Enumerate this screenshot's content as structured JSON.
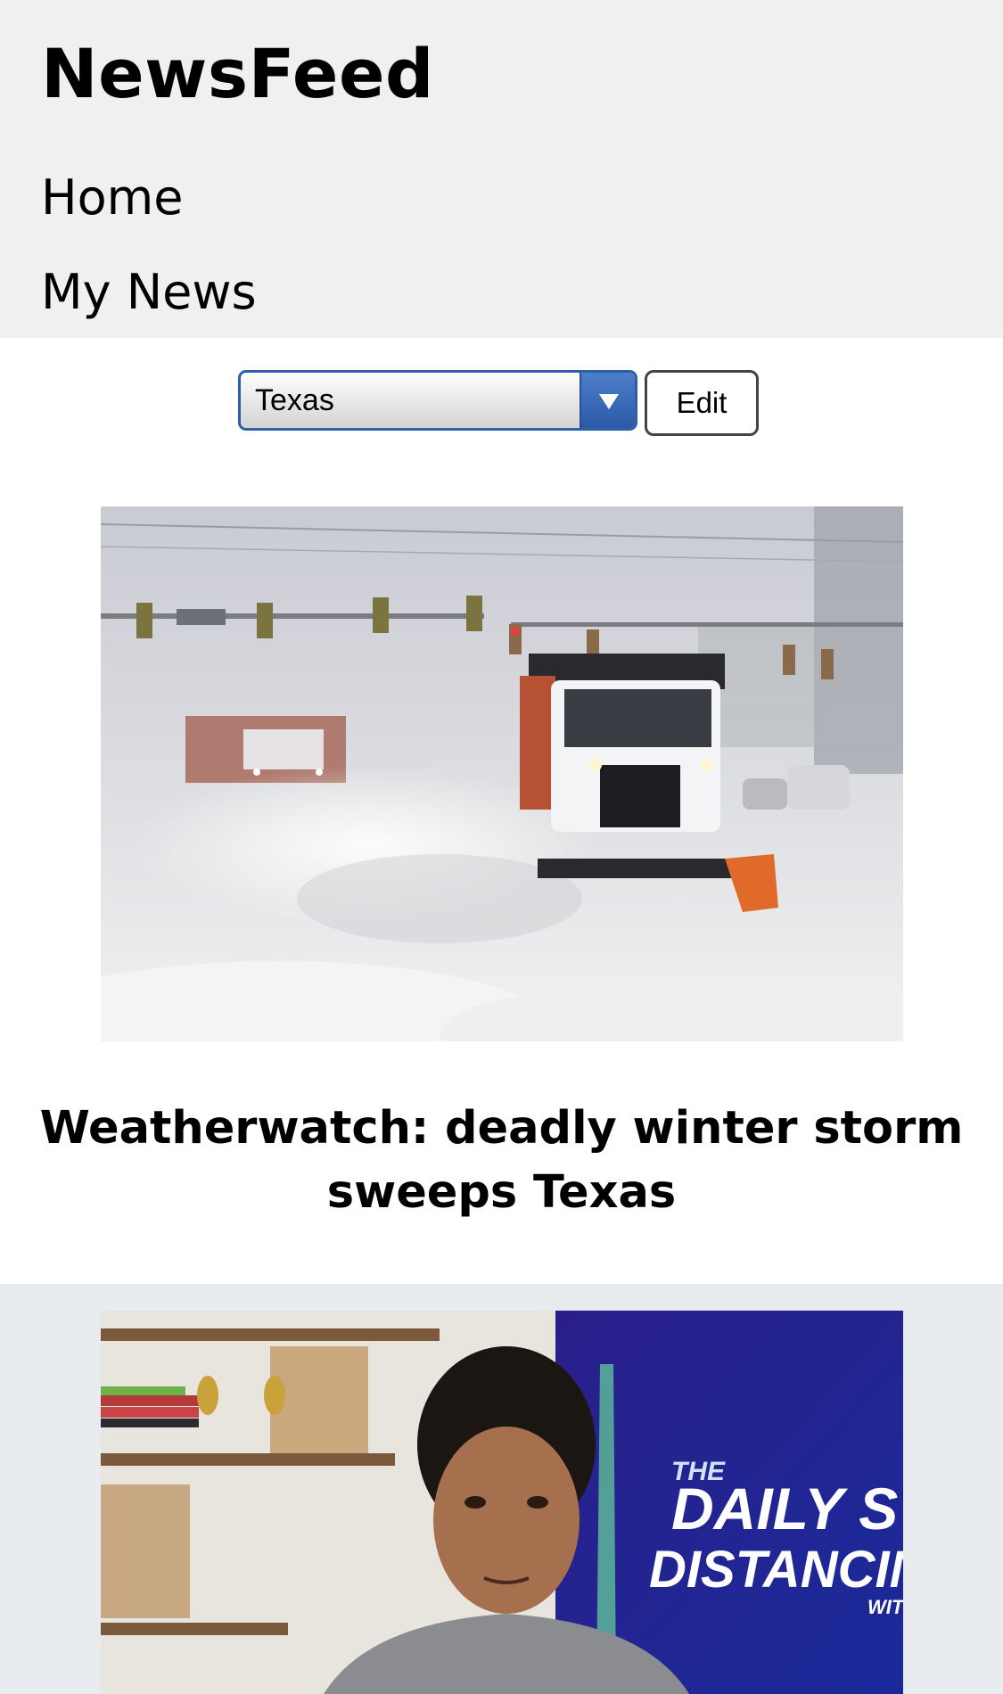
{
  "header": {
    "title": "NewsFeed",
    "nav": [
      {
        "label": "Home"
      },
      {
        "label": "My News"
      }
    ]
  },
  "filter": {
    "selected_region": "Texas",
    "edit_label": "Edit"
  },
  "articles": [
    {
      "headline": "Weatherwatch: deadly winter storm sweeps Texas",
      "image": "snowplow-trucks-in-blizzard-photo"
    },
    {
      "image": "man-in-hoodie-the-daily-social-distancing-show-photo",
      "image_text": [
        "THE",
        "DAILY S",
        "DISTANCIN",
        "WIT"
      ]
    }
  ],
  "colors": {
    "header_bg": "#f0f0f0",
    "select_accent": "#2e5fa6",
    "second_article_bg": "#e9ecef"
  }
}
